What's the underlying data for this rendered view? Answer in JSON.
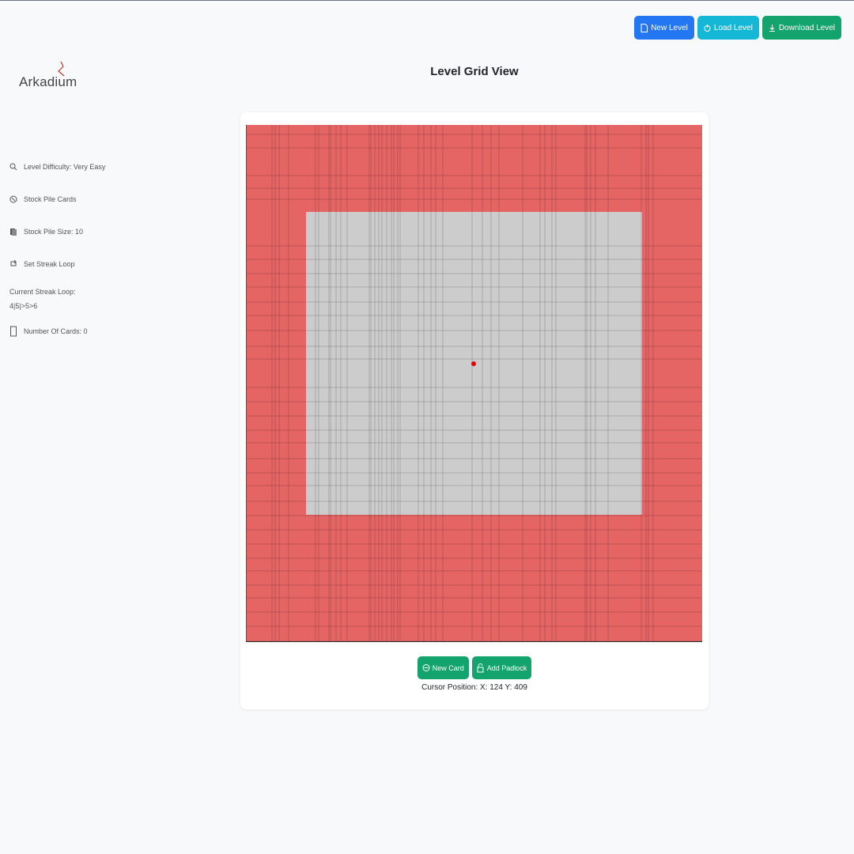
{
  "header": {
    "title": "Level Grid View",
    "logo_text": "Arkadium",
    "buttons": {
      "new_level": "New Level",
      "load_level": "Load Level",
      "download_level": "Download Level"
    }
  },
  "sidebar": {
    "items": [
      {
        "label": "Level Difficulty: Very Easy",
        "icon": "search-icon"
      },
      {
        "label": "Stock Pile Cards",
        "icon": "stock-pile-icon"
      },
      {
        "label": "Stock Pile Size: 10",
        "icon": "stack-icon"
      },
      {
        "label": "Set Streak Loop",
        "icon": "loop-icon"
      }
    ],
    "streak": {
      "label": "Current Streak Loop:",
      "value": "4|5|>5>6"
    },
    "cards_count": {
      "label": "Number Of Cards: 0",
      "icon": "card-icon"
    }
  },
  "grid": {
    "outer_color": "#e56565",
    "inner_color": "#cccccc",
    "marker_color": "#dd0000"
  },
  "actions": {
    "new_card": "New Card",
    "add_padlock": "Add Padlock"
  },
  "status": {
    "cursor_position": "Cursor Position: X: 124 Y: 409"
  },
  "colors": {
    "primary": "#2477f2",
    "info": "#14b8d6",
    "success": "#13a36c"
  }
}
